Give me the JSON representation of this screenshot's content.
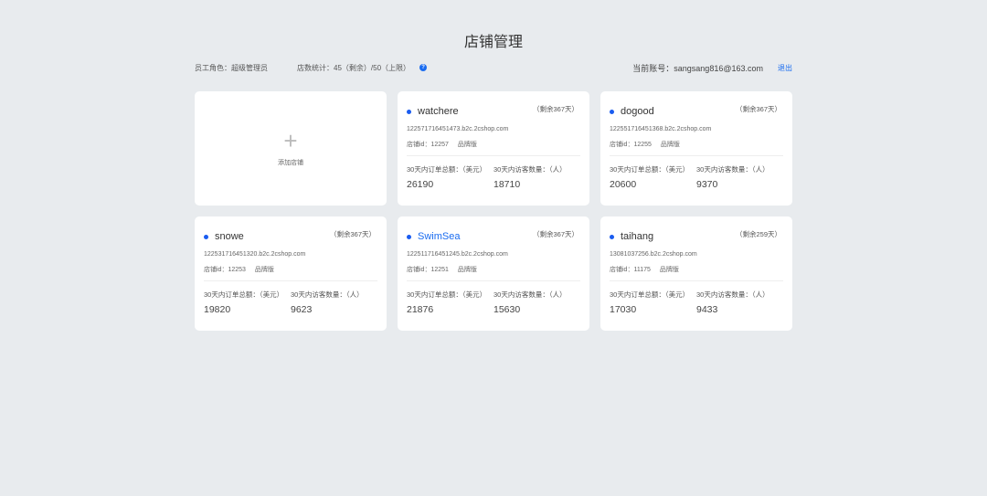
{
  "title": "店铺管理",
  "info": {
    "role": "员工角色：超级管理员",
    "stats": "店数统计：45（剩余）/50（上限）",
    "help_icon": "question-icon",
    "account": "当前账号：sangsang816@163.com",
    "logout": "退出"
  },
  "add_card": {
    "label": "添加店铺"
  },
  "labels": {
    "orders": "30天内订单总额：（美元）",
    "visitors": "30天内访客数量：（人）"
  },
  "shops": [
    {
      "name": "watchere",
      "remain": "（剩余367天）",
      "url": "122571716451473.b2c.2cshop.com",
      "id": "店铺id：12257",
      "edition": "品牌版",
      "orders": "26190",
      "visitors": "18710"
    },
    {
      "name": "dogood",
      "remain": "（剩余367天）",
      "url": "122551716451368.b2c.2cshop.com",
      "id": "店铺id：12255",
      "edition": "品牌版",
      "orders": "20600",
      "visitors": "9370"
    },
    {
      "name": "snowe",
      "remain": "（剩余367天）",
      "url": "122531716451320.b2c.2cshop.com",
      "id": "店铺id：12253",
      "edition": "品牌版",
      "orders": "19820",
      "visitors": "9623"
    },
    {
      "name": "SwimSea",
      "remain": "（剩余367天）",
      "url": "122511716451245.b2c.2cshop.com",
      "id": "店铺id：12251",
      "edition": "品牌版",
      "orders": "21876",
      "visitors": "15630",
      "highlighted": true
    },
    {
      "name": "taihang",
      "remain": "（剩余259天）",
      "url": "13081037256.b2c.2cshop.com",
      "id": "店铺id：11175",
      "edition": "品牌版",
      "orders": "17030",
      "visitors": "9433"
    }
  ]
}
